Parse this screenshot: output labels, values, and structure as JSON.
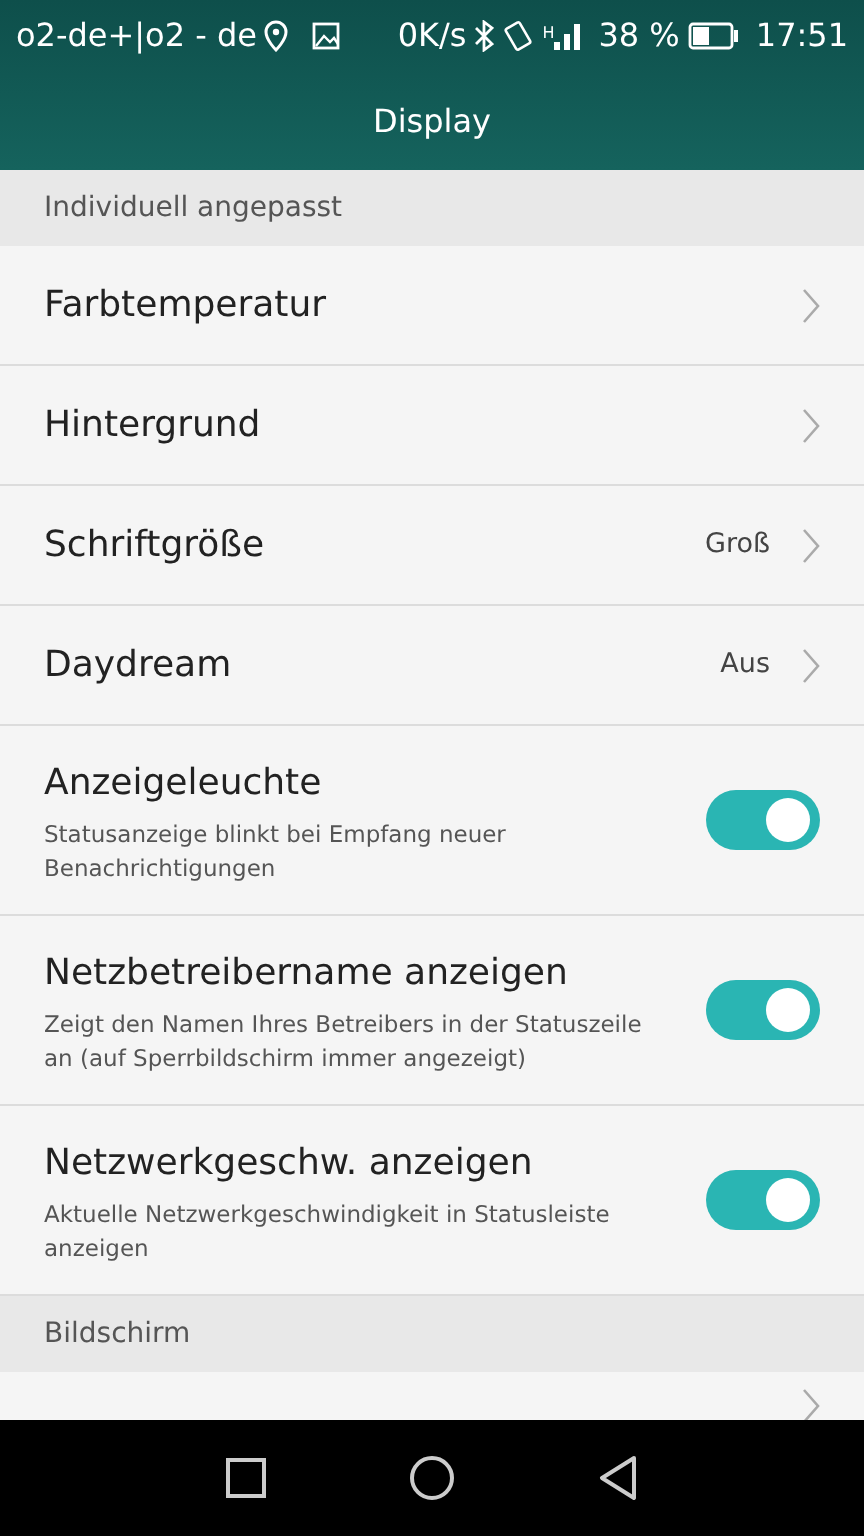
{
  "status_bar": {
    "carrier": "o2-de+|o2 - de",
    "speed": "0K/s",
    "network": "H",
    "battery": "38 %",
    "time": "17:51"
  },
  "title": "Display",
  "sections": [
    {
      "header": "Individuell angepasst",
      "items": [
        {
          "kind": "link",
          "title": "Farbtemperatur"
        },
        {
          "kind": "link",
          "title": "Hintergrund"
        },
        {
          "kind": "link",
          "title": "Schriftgröße",
          "value": "Groß"
        },
        {
          "kind": "link",
          "title": "Daydream",
          "value": "Aus"
        },
        {
          "kind": "toggle",
          "title": "Anzeigeleuchte",
          "description": "Statusanzeige blinkt bei Empfang neuer Benachrichtigungen",
          "on": true
        },
        {
          "kind": "toggle",
          "title": "Netzbetreibername anzeigen",
          "description": "Zeigt den Namen Ihres Betreibers in der Statuszeile an (auf Sperrbildschirm immer angezeigt)",
          "on": true
        },
        {
          "kind": "toggle",
          "title": "Netzwerkgeschw. anzeigen",
          "description": "Aktuelle Netzwerkgeschwindigkeit in Statusleiste anzeigen",
          "on": true
        }
      ]
    },
    {
      "header": "Bildschirm",
      "items": [
        {
          "kind": "link"
        }
      ]
    }
  ]
}
